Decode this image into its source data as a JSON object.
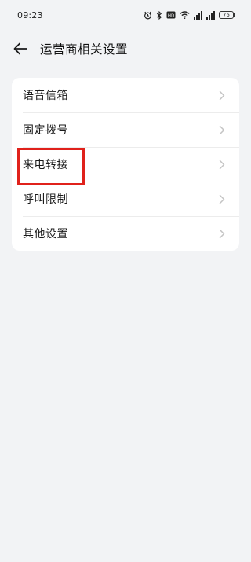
{
  "status_bar": {
    "time": "09:23",
    "battery": "75"
  },
  "header": {
    "title": "运营商相关设置"
  },
  "settings": {
    "items": [
      {
        "label": "语音信箱"
      },
      {
        "label": "固定拨号"
      },
      {
        "label": "来电转接"
      },
      {
        "label": "呼叫限制"
      },
      {
        "label": "其他设置"
      }
    ]
  },
  "highlight": {
    "color": "#e0211b",
    "target": "来电转接"
  }
}
